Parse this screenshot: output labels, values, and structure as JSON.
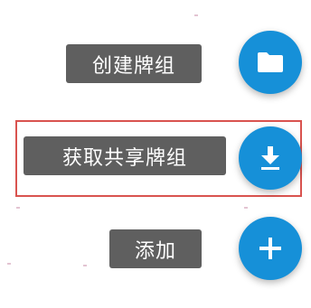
{
  "menu": {
    "items": [
      {
        "label": "创建牌组",
        "icon": "folder-icon"
      },
      {
        "label": "获取共享牌组",
        "icon": "download-icon"
      },
      {
        "label": "添加",
        "icon": "plus-icon"
      }
    ]
  },
  "colors": {
    "fab": "#1690d8",
    "label_bg": "#5f5f5f",
    "highlight": "#d9534f"
  }
}
